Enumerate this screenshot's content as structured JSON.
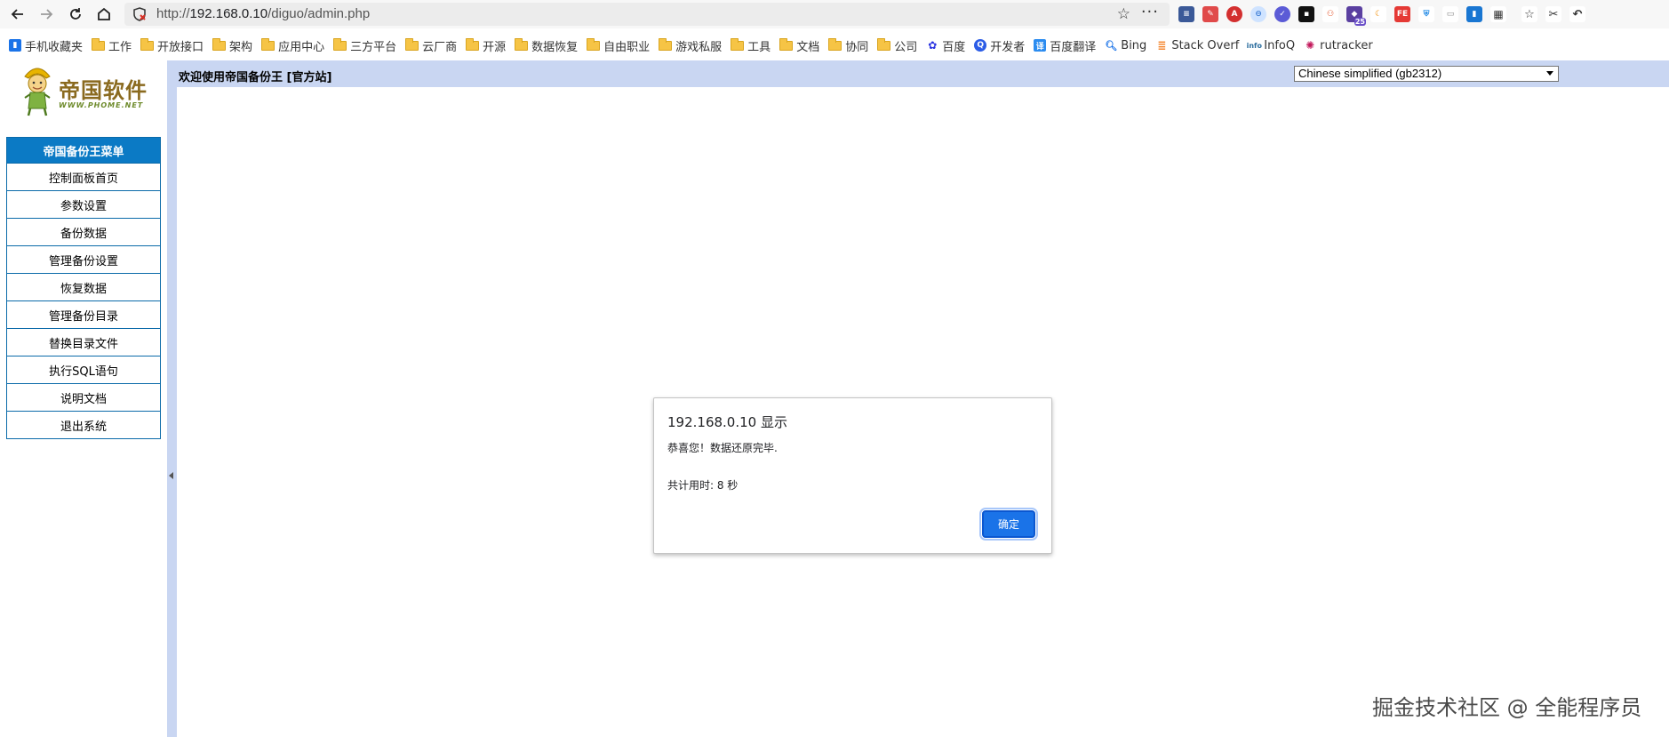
{
  "browser": {
    "url_scheme": "http://",
    "url_host": "192.168.0.10",
    "url_path": "/diguo/admin.php",
    "extensions": [
      "flag-ext",
      "pen-ext",
      "abp-ext",
      "translate-ext",
      "check-ext",
      "video-ext",
      "share-ext",
      "badge-ext",
      "moon-ext",
      "fe-ext",
      "shield-ext",
      "reader-ext",
      "sidebar-ext",
      "grid-ext"
    ],
    "extension_badge": "25"
  },
  "bookmarks": [
    {
      "label": "手机收藏夹",
      "icon": "mobile-icon"
    },
    {
      "label": "工作",
      "icon": "folder-icon"
    },
    {
      "label": "开放接口",
      "icon": "folder-icon"
    },
    {
      "label": "架构",
      "icon": "folder-icon"
    },
    {
      "label": "应用中心",
      "icon": "folder-icon"
    },
    {
      "label": "三方平台",
      "icon": "folder-icon"
    },
    {
      "label": "云厂商",
      "icon": "folder-icon"
    },
    {
      "label": "开源",
      "icon": "folder-icon"
    },
    {
      "label": "数据恢复",
      "icon": "folder-icon"
    },
    {
      "label": "自由职业",
      "icon": "folder-icon"
    },
    {
      "label": "游戏私服",
      "icon": "folder-icon"
    },
    {
      "label": "工具",
      "icon": "folder-icon"
    },
    {
      "label": "文档",
      "icon": "folder-icon"
    },
    {
      "label": "协同",
      "icon": "folder-icon"
    },
    {
      "label": "公司",
      "icon": "folder-icon"
    },
    {
      "label": "百度",
      "icon": "baidu-icon"
    },
    {
      "label": "开发者",
      "icon": "dev-icon"
    },
    {
      "label": "百度翻译",
      "icon": "translate-icon"
    },
    {
      "label": "Bing",
      "icon": "bing-icon"
    },
    {
      "label": "Stack Overf",
      "icon": "stackoverflow-icon"
    },
    {
      "label": "InfoQ",
      "icon": "infoq-icon"
    },
    {
      "label": "rutracker",
      "icon": "rutracker-icon"
    }
  ],
  "logo": {
    "text": "帝国软件",
    "sub": "WWW.PHOME.NET"
  },
  "menu": {
    "title": "帝国备份王菜单",
    "items": [
      "控制面板首页",
      "参数设置",
      "备份数据",
      "管理备份设置",
      "恢复数据",
      "管理备份目录",
      "替换目录文件",
      "执行SQL语句",
      "说明文档",
      "退出系统"
    ]
  },
  "header": {
    "welcome": "欢迎使用帝国备份王 [官方站]",
    "charset": "Chinese simplified (gb2312)"
  },
  "dialog": {
    "title": "192.168.0.10 显示",
    "message": "恭喜您！数据还原完毕.",
    "elapsed": "共计用时: 8 秒",
    "ok_label": "确定"
  },
  "watermark": "掘金技术社区 @ 全能程序员",
  "colors": {
    "menu_head": "#0b7ac5",
    "header_bar": "#c9d6f2",
    "ok_button": "#1a73e8"
  }
}
